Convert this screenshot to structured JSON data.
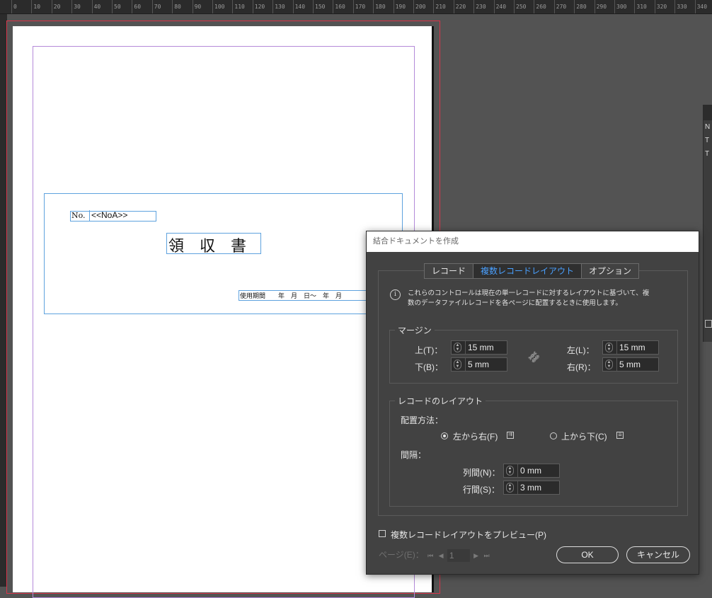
{
  "ruler": {
    "labels": [
      "0",
      "10",
      "20",
      "30",
      "40",
      "50",
      "60",
      "70",
      "80",
      "90",
      "100",
      "110",
      "120",
      "130",
      "140",
      "150",
      "160",
      "170",
      "180",
      "190",
      "200",
      "210",
      "220",
      "230",
      "240",
      "250",
      "260",
      "270",
      "280",
      "290",
      "300",
      "310",
      "320",
      "330",
      "340"
    ]
  },
  "document": {
    "no_label": "No.",
    "no_field": "<<NoA>>",
    "title": "領収書",
    "period": "使用期間　　年　月　日～　年　月"
  },
  "side_panel": {
    "letters": [
      "N",
      "T",
      "T"
    ]
  },
  "dialog": {
    "title": "結合ドキュメントを作成",
    "tabs": [
      {
        "label": "レコード",
        "active": false
      },
      {
        "label": "複数レコードレイアウト",
        "active": true
      },
      {
        "label": "オプション",
        "active": false
      }
    ],
    "info_icon_glyph": "i",
    "info_line1": "これらのコントロールは現在の単一レコードに対するレイアウトに基づいて、複",
    "info_line2": "数のデータファイルレコードを各ページに配置するときに使用します。",
    "margin": {
      "legend": "マージン",
      "top_label": "上(T)：",
      "top_value": "15 mm",
      "bottom_label": "下(B)：",
      "bottom_value": "5 mm",
      "left_label": "左(L)：",
      "left_value": "15 mm",
      "right_label": "右(R)：",
      "right_value": "5 mm",
      "link_icon": "link-icon"
    },
    "record_layout": {
      "legend": "レコードのレイアウト",
      "arrangement_label": "配置方法：",
      "option_left_to_right": "左から右(F)",
      "option_top_to_bottom": "上から下(C)",
      "selected": "左から右(F)",
      "spacing_label": "間隔：",
      "column_label": "列間(N)：",
      "column_value": "0 mm",
      "row_label": "行間(S)：",
      "row_value": "3 mm"
    },
    "preview_label": "複数レコードレイアウトをプレビュー(P)",
    "preview_checked": false,
    "page_label": "ページ(E)：",
    "page_value": "1",
    "ok_label": "OK",
    "cancel_label": "キャンセル"
  },
  "colors": {
    "workspace": "#535353",
    "dialog_bg": "#424242",
    "active_tab_text": "#4aa0ff",
    "frame_blue": "#5ea2de",
    "bleed_red": "#d8354a",
    "margin_purple": "#b48ad9"
  }
}
